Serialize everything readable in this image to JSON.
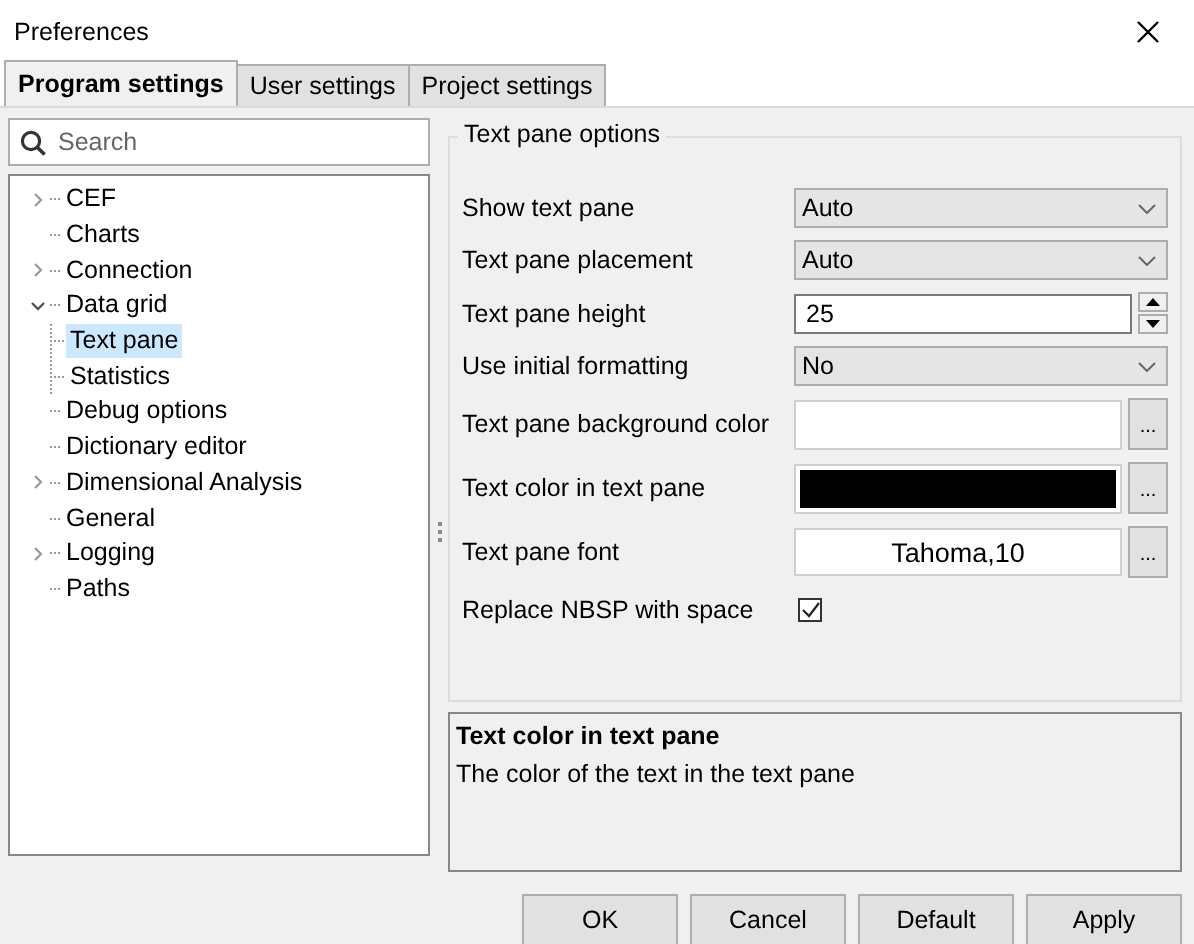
{
  "window": {
    "title": "Preferences"
  },
  "tabs": [
    {
      "label": "Program settings",
      "selected": true
    },
    {
      "label": "User settings",
      "selected": false
    },
    {
      "label": "Project settings",
      "selected": false
    }
  ],
  "search": {
    "placeholder": "Search"
  },
  "tree": [
    {
      "label": "CEF",
      "expanded": false,
      "selected": false
    },
    {
      "label": "Charts",
      "selected": false
    },
    {
      "label": "Connection",
      "expanded": false,
      "selected": false
    },
    {
      "label": "Data grid",
      "expanded": true,
      "selected": false,
      "children": [
        {
          "label": "Text pane",
          "selected": true
        },
        {
          "label": "Statistics",
          "selected": false
        }
      ]
    },
    {
      "label": "Debug options",
      "selected": false
    },
    {
      "label": "Dictionary editor",
      "selected": false
    },
    {
      "label": "Dimensional Analysis",
      "expanded": false,
      "selected": false
    },
    {
      "label": "General",
      "selected": false
    },
    {
      "label": "Logging",
      "expanded": false,
      "selected": false
    },
    {
      "label": "Paths",
      "selected": false
    }
  ],
  "group": {
    "title": "Text pane options",
    "settings": [
      {
        "kind": "dropdown",
        "label": "Show text pane",
        "value": "Auto"
      },
      {
        "kind": "dropdown",
        "label": "Text pane placement",
        "value": "Auto"
      },
      {
        "kind": "spin",
        "label": "Text pane height",
        "value": "25"
      },
      {
        "kind": "dropdown",
        "label": "Use initial formatting",
        "value": "No"
      },
      {
        "kind": "color",
        "label": "Text pane background color",
        "color": "#ffffff",
        "button": "..."
      },
      {
        "kind": "color",
        "label": "Text color in text pane",
        "color": "#000000",
        "button": "..."
      },
      {
        "kind": "font",
        "label": "Text pane font",
        "value": "Tahoma,10",
        "button": "..."
      },
      {
        "kind": "checkbox",
        "label": "Replace NBSP with space",
        "checked": true
      }
    ]
  },
  "description": {
    "title": "Text color in text pane",
    "text": "The color of the text in the text pane"
  },
  "buttons": [
    "OK",
    "Cancel",
    "Default",
    "Apply"
  ]
}
